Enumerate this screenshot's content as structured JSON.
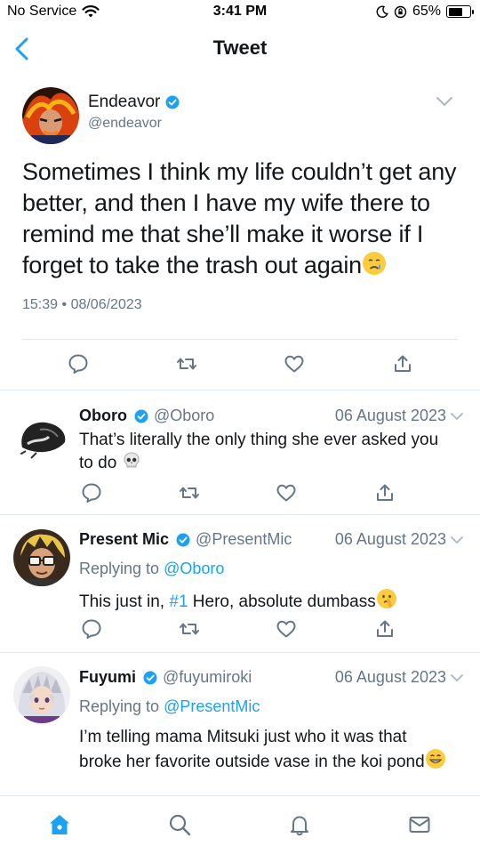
{
  "status_bar": {
    "carrier": "No Service",
    "time": "3:41 PM",
    "battery": "65%",
    "battery_level": 0.65
  },
  "nav": {
    "title": "Tweet"
  },
  "main_tweet": {
    "author_name": "Endeavor",
    "author_handle": "@endeavor",
    "text": "Sometimes I think my life couldn’t get any better, and then I have my wife there to remind me that she’ll make it worse if I forget to take the trash out again",
    "emoji": "crying-face",
    "time": "15:39",
    "separator": "•",
    "date": "08/06/2023"
  },
  "replies": [
    {
      "name": "Oboro",
      "handle": "@Oboro",
      "date": "06 August 2023",
      "replying_prefix": "",
      "replying_to": "",
      "text": "That’s literally the only thing she ever asked you to do",
      "emoji": "skull"
    },
    {
      "name": "Present Mic",
      "handle": "@PresentMic",
      "date": "06 August 2023",
      "replying_prefix": "Replying to",
      "replying_to": "@Oboro",
      "text_before": "This just in, ",
      "hashtag": "#1",
      "text_after": " Hero, absolute dumbass",
      "emoji": "shushing-face"
    },
    {
      "name": "Fuyumi",
      "handle": "@fuyumiroki",
      "date": "06 August 2023",
      "replying_prefix": "Replying to",
      "replying_to": "@PresentMic",
      "text": "I’m telling mama Mitsuki just who it was that broke her favorite outside vase in the koi pond",
      "emoji": "grinning-face"
    }
  ],
  "colors": {
    "accent": "#1da1f2",
    "secondary_text": "#657786",
    "divider": "#e1e8ed"
  },
  "tabbar": {
    "tabs": [
      "home-icon",
      "search-icon",
      "notifications-icon",
      "messages-icon"
    ],
    "active": "home-icon"
  }
}
